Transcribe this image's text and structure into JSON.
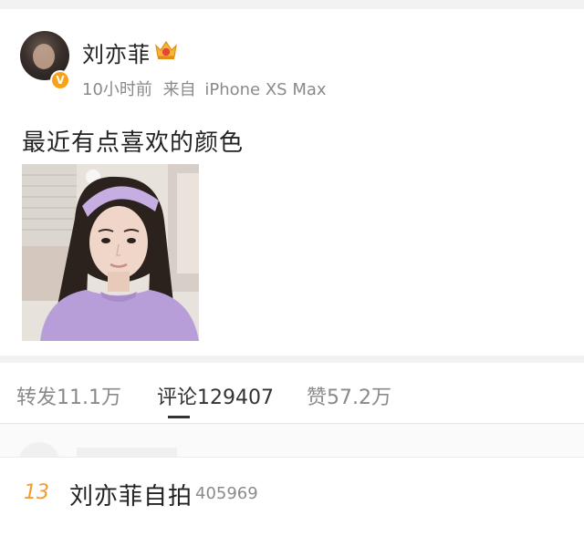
{
  "post": {
    "author": "刘亦菲",
    "time": "10小时前",
    "source_prefix": "来自",
    "device": "iPhone XS Max",
    "text": "最近有点喜欢的颜色",
    "verified_badge": "V"
  },
  "tabs": [
    {
      "label": "转发11.1万"
    },
    {
      "label": "评论129407"
    },
    {
      "label": "赞57.2万"
    }
  ],
  "active_tab": "评论129407",
  "hot_search": {
    "rank": "13",
    "topic": "刘亦菲自拍",
    "heat": "405969"
  },
  "colors": {
    "rank": "#f39c2b",
    "verified": "#f7a21b",
    "muted": "#8a8a8a",
    "photo_top": "#b59bd6"
  },
  "icons": [
    "vip-crown-icon",
    "verified-icon"
  ]
}
